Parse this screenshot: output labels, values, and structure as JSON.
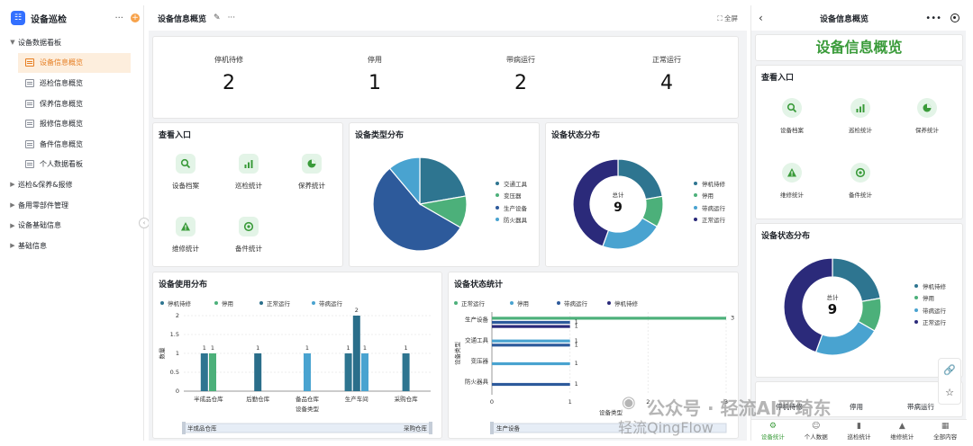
{
  "sidebar": {
    "title": "设备巡检",
    "more": "···",
    "add": "+",
    "groups": [
      {
        "label": "设备数据看板",
        "expanded": true
      },
      {
        "label": "巡检&保养&报修"
      },
      {
        "label": "备用零部件管理"
      },
      {
        "label": "设备基础信息"
      },
      {
        "label": "基础信息"
      }
    ],
    "pages": [
      "设备信息概览",
      "巡检信息概览",
      "保养信息概览",
      "报修信息概览",
      "备件信息概览",
      "个人数据看板"
    ]
  },
  "header": {
    "title": "设备信息概览",
    "more": "···",
    "fullscreen": "全屏"
  },
  "stats": [
    {
      "label": "停机待修",
      "value": "2"
    },
    {
      "label": "停用",
      "value": "1"
    },
    {
      "label": "带病运行",
      "value": "2"
    },
    {
      "label": "正常运行",
      "value": "4"
    }
  ],
  "entry": {
    "title": "查看入口",
    "items": [
      {
        "label": "设备档案",
        "icon": "search-icon"
      },
      {
        "label": "巡检统计",
        "icon": "bar-chart-icon"
      },
      {
        "label": "保养统计",
        "icon": "pie-chart-icon"
      },
      {
        "label": "维修统计",
        "icon": "warning-icon"
      },
      {
        "label": "备件统计",
        "icon": "parts-icon"
      }
    ]
  },
  "colors": {
    "accent": "#e67e22",
    "green": "#3a9b3a",
    "c1": "#2e7590",
    "c2": "#4cb07a",
    "c3": "#2d5a9b",
    "c4": "#49a3d0",
    "c5": "#2b2a7a"
  },
  "chart_data": [
    {
      "type": "pie",
      "title": "设备类型分布",
      "labels": [
        "交通工具",
        "变压器",
        "生产设备",
        "防火器具"
      ],
      "values": [
        2,
        1,
        5,
        1
      ],
      "colors": [
        "#2e7590",
        "#4cb07a",
        "#2d5a9b",
        "#49a3d0"
      ]
    },
    {
      "type": "pie",
      "title": "设备状态分布",
      "center_label": "总计",
      "center_value": "9",
      "labels": [
        "停机待修",
        "停用",
        "带病运行",
        "正常运行"
      ],
      "values": [
        2,
        1,
        2,
        4
      ],
      "colors": [
        "#2e7590",
        "#4cb07a",
        "#49a3d0",
        "#2b2a7a"
      ]
    },
    {
      "type": "bar",
      "title": "设备使用分布",
      "categories": [
        "半成品仓库",
        "后勤仓库",
        "备品仓库",
        "生产车间",
        "采购仓库"
      ],
      "series": [
        {
          "name": "停机待修",
          "values": [
            1,
            0,
            0,
            1,
            1
          ],
          "color": "#2e7590"
        },
        {
          "name": "停用",
          "values": [
            1,
            0,
            0,
            0,
            0
          ],
          "color": "#4cb07a"
        },
        {
          "name": "正常运行",
          "values": [
            0,
            1,
            0,
            2,
            0
          ],
          "color": "#2a6e8a"
        },
        {
          "name": "带病运行",
          "values": [
            0,
            0,
            1,
            1,
            0
          ],
          "color": "#49a3d0"
        }
      ],
      "xlabel": "设备类型",
      "ylabel": "数量",
      "ylim": [
        0,
        2
      ],
      "yticks": [
        0,
        0.5,
        1,
        1.5,
        2
      ],
      "slider_left": "半成品仓库",
      "slider_right": "采购仓库"
    },
    {
      "type": "bar",
      "title": "设备状态统计",
      "orientation": "horizontal",
      "categories": [
        "生产设备",
        "交通工具",
        "变压器",
        "防火器具"
      ],
      "series": [
        {
          "name": "正常运行",
          "values": [
            3,
            0,
            0,
            0
          ],
          "color": "#4cb07a"
        },
        {
          "name": "停用",
          "values": [
            0,
            1,
            1,
            0
          ],
          "color": "#49a3d0"
        },
        {
          "name": "带病运行",
          "values": [
            1,
            1,
            0,
            1
          ],
          "color": "#2d5a9b"
        },
        {
          "name": "停机待修",
          "values": [
            1,
            0,
            0,
            0
          ],
          "color": "#2b2a7a"
        }
      ],
      "xlabel": "设备类型",
      "ylabel": "设备类型",
      "xlim": [
        0,
        3
      ],
      "xticks": [
        0,
        1,
        2,
        3
      ],
      "slider_left": "生产设备"
    }
  ],
  "mobile": {
    "title": "设备信息概览",
    "big_title": "设备信息概览",
    "entry_title": "查看入口",
    "chart_title": "设备状态分布",
    "bottom_labels": [
      "停机待修",
      "停用",
      "带病运行"
    ],
    "tabs": [
      "设备统计",
      "个人数据",
      "巡检统计",
      "维修统计",
      "全部内容"
    ]
  },
  "watermark": {
    "line1": "公众号 · 轻流AI严琦东",
    "line2": "轻流QingFlow"
  }
}
